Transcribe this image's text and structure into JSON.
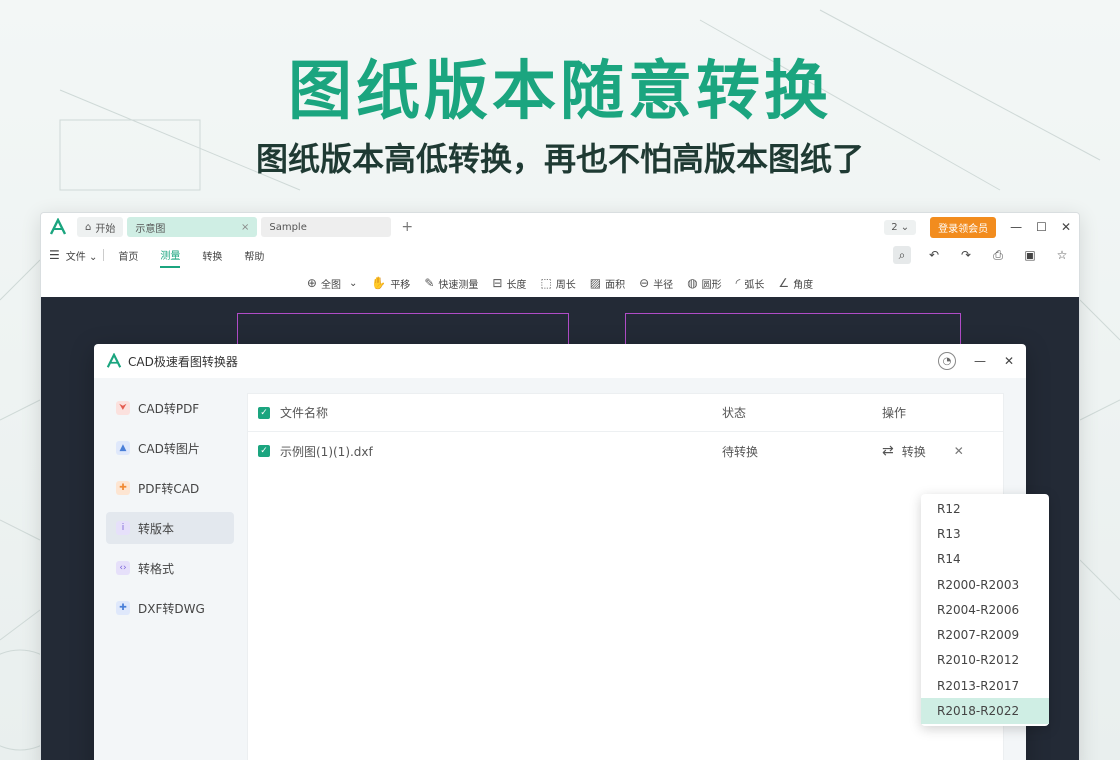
{
  "hero": {
    "title": "图纸版本随意转换",
    "subtitle": "图纸版本高低转换，再也不怕高版本图纸了"
  },
  "app": {
    "tabs": [
      {
        "label": "开始"
      },
      {
        "label": "示意图"
      },
      {
        "label": "Sample"
      }
    ],
    "tab_count": "2",
    "vip_button": "登录领会员",
    "menu": {
      "file": "文件",
      "items": [
        "首页",
        "测量",
        "转换",
        "帮助"
      ],
      "active": "测量"
    },
    "toolbar": [
      {
        "icon": "fit-all-icon",
        "label": "全图"
      },
      {
        "icon": "pan-hand-icon",
        "label": "平移"
      },
      {
        "icon": "quick-measure-icon",
        "label": "快速测量"
      },
      {
        "icon": "length-icon",
        "label": "长度"
      },
      {
        "icon": "perimeter-icon",
        "label": "周长"
      },
      {
        "icon": "area-icon",
        "label": "面积"
      },
      {
        "icon": "radius-icon",
        "label": "半径"
      },
      {
        "icon": "circle-icon",
        "label": "圆形"
      },
      {
        "icon": "arc-icon",
        "label": "弧长"
      },
      {
        "icon": "angle-icon",
        "label": "角度"
      }
    ]
  },
  "dialog": {
    "title": "CAD极速看图转换器",
    "sidebar": [
      {
        "label": "CAD转PDF",
        "icon": "pdf-icon",
        "color": "#e35b4f"
      },
      {
        "label": "CAD转图片",
        "icon": "image-icon",
        "color": "#4a7fd8"
      },
      {
        "label": "PDF转CAD",
        "icon": "pdf-cad-icon",
        "color": "#f08a34"
      },
      {
        "label": "转版本",
        "icon": "version-icon",
        "color": "#7a63d9"
      },
      {
        "label": "转格式",
        "icon": "format-icon",
        "color": "#7a63d9"
      },
      {
        "label": "DXF转DWG",
        "icon": "dxf-icon",
        "color": "#4a7fd8"
      }
    ],
    "active_side": "转版本",
    "table": {
      "headers": {
        "name": "文件名称",
        "status": "状态",
        "op": "操作"
      },
      "rows": [
        {
          "name": "示例图(1)(1).dxf",
          "status": "待转换",
          "op": "转换"
        }
      ]
    },
    "version_options": [
      "R12",
      "R13",
      "R14",
      "R2000-R2003",
      "R2004-R2006",
      "R2007-R2009",
      "R2010-R2012",
      "R2013-R2017",
      "R2018-R2022"
    ],
    "selected_version": "R2018-R2022"
  },
  "colors": {
    "accent": "#1ba57f",
    "vip": "#f28c1e",
    "canvas": "#232a36"
  }
}
